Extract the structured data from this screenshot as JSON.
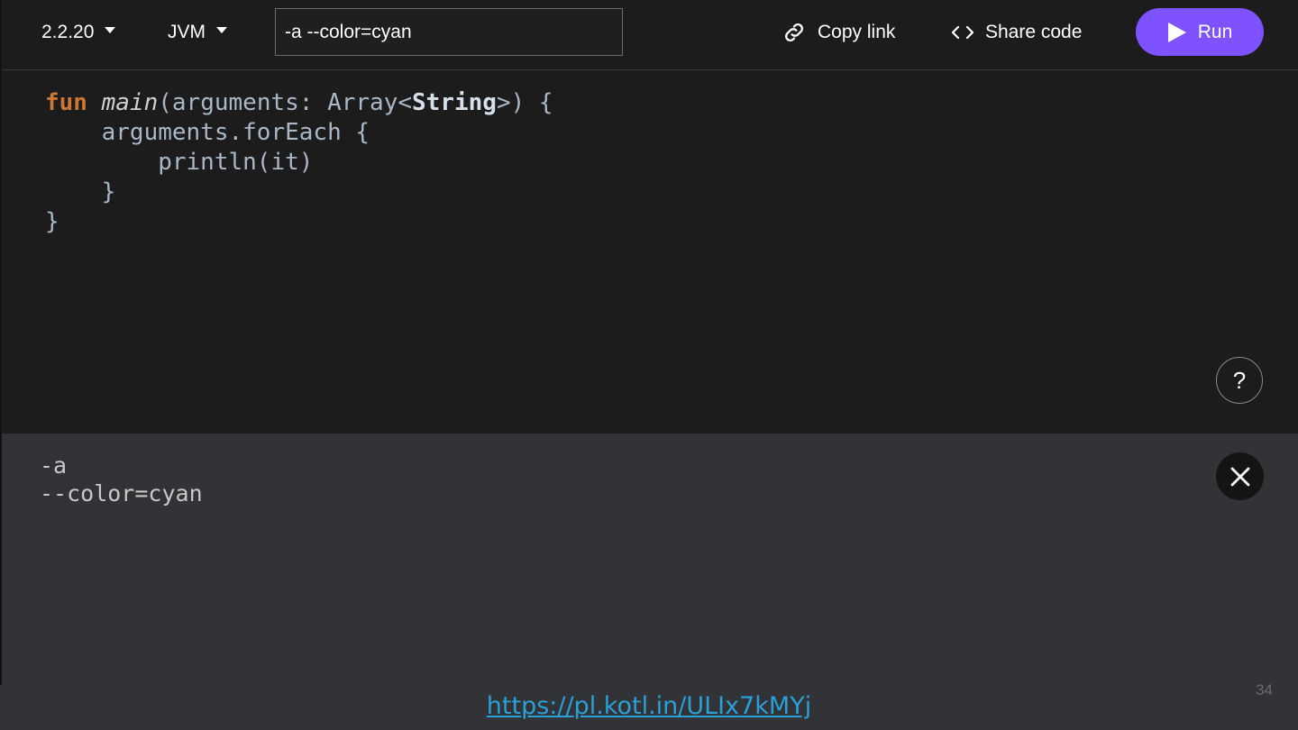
{
  "toolbar": {
    "version": "2.2.20",
    "target": "JVM",
    "program_args": "-a --color=cyan",
    "copy_link_label": "Copy link",
    "share_code_label": "Share code",
    "run_label": "Run"
  },
  "editor": {
    "lines": [
      {
        "kw": "fun",
        "fn": "main",
        "pre": "(arguments: Array<",
        "type": "String",
        "post": ">) {"
      },
      {
        "text": "    arguments.forEach {"
      },
      {
        "text": "        println(it)"
      },
      {
        "text": "    }"
      },
      {
        "text": "}"
      }
    ],
    "help_label": "?"
  },
  "output": {
    "lines": [
      "-a",
      "--color=cyan"
    ]
  },
  "footer": {
    "link": "https://pl.kotl.in/ULIx7kMYj",
    "page_number": "34"
  },
  "colors": {
    "accent": "#7f52ff",
    "keyword": "#cc7832",
    "link": "#2aa0d8",
    "editor_bg": "#1c1c1c",
    "output_bg": "#323336"
  },
  "icons": [
    "caret-down-icon",
    "link-icon",
    "code-brackets-icon",
    "play-icon",
    "close-icon"
  ]
}
